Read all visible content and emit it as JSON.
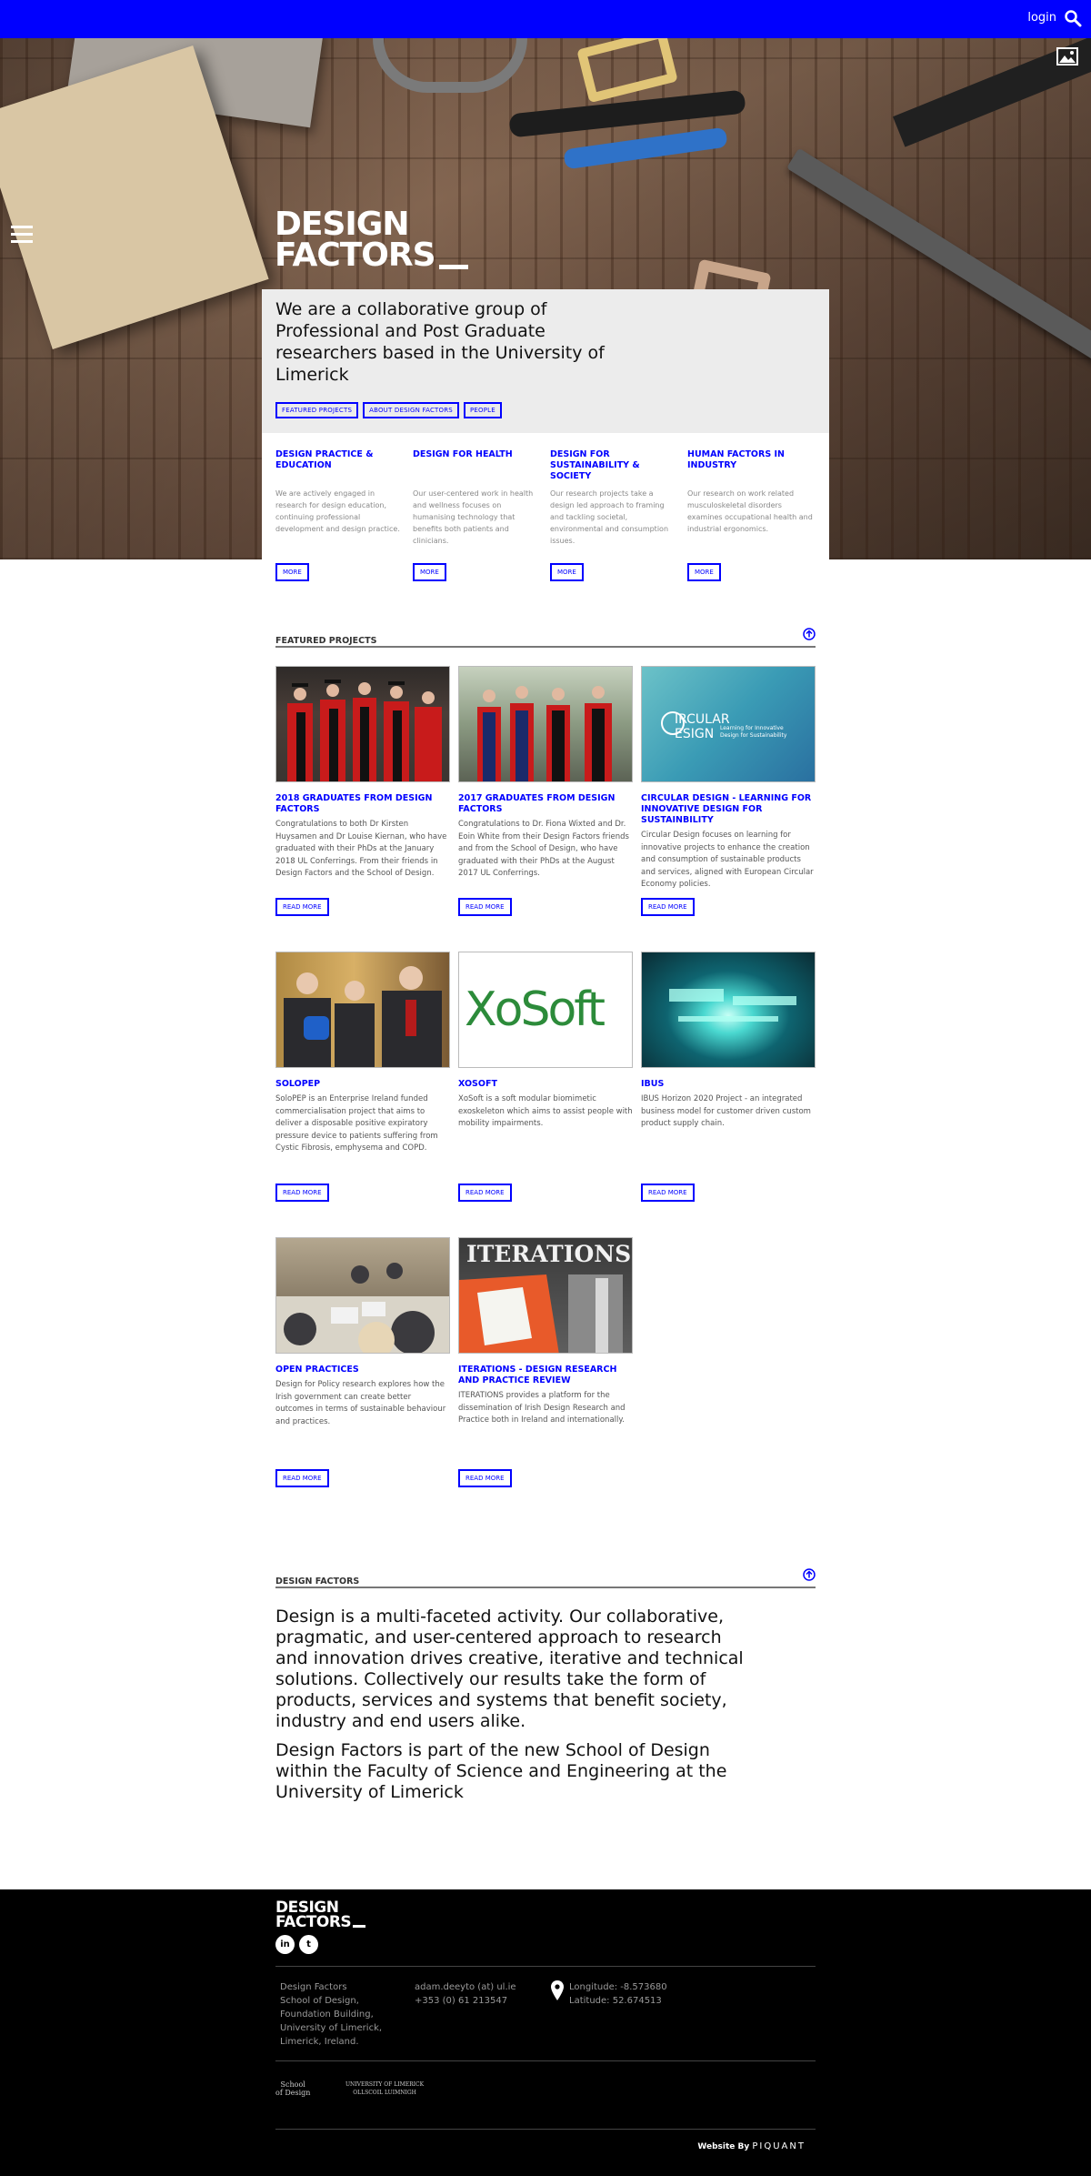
{
  "topbar": {
    "login_label": "login"
  },
  "hero": {
    "logo_line1": "DESIGN",
    "logo_line2": "FACTORS",
    "intro_text": "We are a collaborative group of Professional and Post Graduate researchers based in the University of Limerick",
    "pills": [
      "FEATURED PROJECTS",
      "ABOUT DESIGN FACTORS",
      "PEOPLE"
    ]
  },
  "areas": [
    {
      "title": "DESIGN PRACTICE & EDUCATION",
      "text": "We are actively engaged in research for design education, continuing professional development and design practice.",
      "button": "MORE"
    },
    {
      "title": "DESIGN FOR HEALTH",
      "text": "Our user-centered work in health and wellness focuses on humanising technology that benefits both patients and clinicians.",
      "button": "MORE"
    },
    {
      "title": "DESIGN FOR SUSTAINABILITY & SOCIETY",
      "text": "Our research projects take a design led approach to framing and tackling societal, environmental and consumption issues.",
      "button": "MORE"
    },
    {
      "title": "HUMAN FACTORS IN INDUSTRY",
      "text": "Our research on work related musculoskeletal disorders examines occupational health and industrial ergonomics.",
      "button": "MORE"
    }
  ],
  "featured": {
    "heading": "FEATURED PROJECTS",
    "button_label": "READ MORE",
    "projects": [
      {
        "title": "2018 GRADUATES FROM DESIGN FACTORS",
        "text": "Congratulations to both Dr Kirsten Huysamen and Dr Louise Kiernan, who have graduated with their PhDs at the January 2018 UL Conferrings. From their friends in Design Factors and the School of Design."
      },
      {
        "title": "2017 GRADUATES FROM DESIGN FACTORS",
        "text": "Congratulations to Dr. Fiona Wixted and Dr. Eoin White from their Design Factors friends and from the School of Design, who have graduated with their PhDs at the August 2017 UL Conferrings."
      },
      {
        "title": "CIRCULAR DESIGN - LEARNING FOR INNOVATIVE DESIGN FOR SUSTAINBILITY",
        "text": "Circular Design focuses on learning for innovative projects to enhance the creation and consumption of sustainable products and services, aligned with European Circular Economy policies."
      },
      {
        "title": "SOLOPEP",
        "text": "SoloPEP is an Enterprise Ireland funded commercialisation project that aims to deliver a disposable positive expiratory pressure device to patients suffering from Cystic Fibrosis, emphysema and COPD."
      },
      {
        "title": "XOSOFT",
        "text": "XoSoft is a soft modular biomimetic exoskeleton which aims to assist people with mobility impairments."
      },
      {
        "title": "IBUS",
        "text": "IBUS Horizon 2020 Project - an integrated business model for customer driven custom product supply chain."
      },
      {
        "title": "OPEN PRACTICES",
        "text": "Design for Policy research explores how the Irish government can create better outcomes in terms of sustainable behaviour and practices."
      },
      {
        "title": "ITERATIONS - DESIGN RESEARCH AND PRACTICE REVIEW",
        "text": "ITERATIONS provides a platform for the dissemination of Irish Design Research and Practice both in Ireland and internationally."
      }
    ],
    "thumb_text": {
      "circular_line1": "IRCULAR",
      "circular_line2": "ESIGN",
      "circular_sub1": "Learning for Innovative",
      "circular_sub2": "Design for Sustainability",
      "xosoft": "XoSoft",
      "iterations": "ITERATIONS"
    }
  },
  "about": {
    "heading": "DESIGN FACTORS",
    "para1": "Design is a multi-faceted activity. Our collaborative, pragmatic, and user-centered approach to research and innovation drives creative, iterative and technical solutions. Collectively our results take the form of products, services and systems that benefit society, industry and end users alike.",
    "para2": "Design Factors is part of the new School of Design within the Faculty of Science and Engineering at the University of Limerick"
  },
  "footer": {
    "logo_line1": "DESIGN",
    "logo_line2": "FACTORS",
    "social": [
      "in",
      "t"
    ],
    "address": [
      "Design Factors",
      "School of Design,",
      "Foundation Building,",
      "University of Limerick,",
      "Limerick, Ireland."
    ],
    "email": "adam.deeyto (at) ul.ie",
    "phone": "+353 (0) 61 213547",
    "longitude": "Longitude: -8.573680",
    "latitude": "Latitude: 52.674513",
    "partner1_line1": "School",
    "partner1_line2": "of Design",
    "partner2_line1": "UNIVERSITY OF LIMERICK",
    "partner2_line2": "OLLSCOIL LUIMNIGH",
    "website_by": "Website By",
    "agency": "PIQUANT"
  },
  "colors": {
    "accent": "#0000ff",
    "footer_bg": "#000000",
    "panel_bg": "#ececec"
  }
}
